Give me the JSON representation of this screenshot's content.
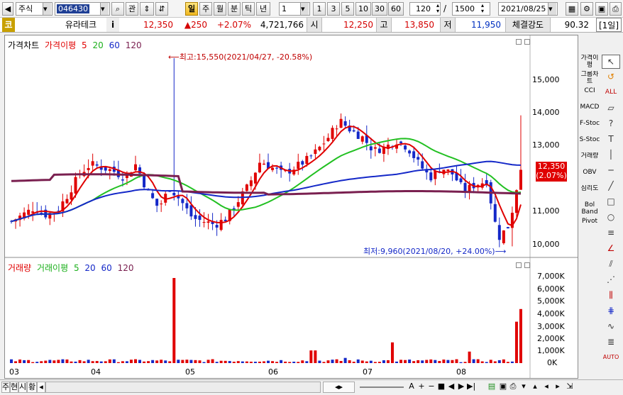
{
  "toolbar": {
    "market": "주식",
    "code": "046430",
    "related_label": "관",
    "periods": [
      "일",
      "주",
      "월",
      "분",
      "틱",
      "년"
    ],
    "interval": "1",
    "multipliers": [
      "1",
      "3",
      "5",
      "10",
      "30",
      "60"
    ],
    "view_count": "120",
    "total_count": "1500",
    "date": "2021/08/25"
  },
  "quote": {
    "market_tag": "코",
    "name": "유라테크",
    "info": "i",
    "price": "12,350",
    "change": "▲250",
    "change_pct": "+2.07%",
    "volume": "4,721,766",
    "open_label": "시",
    "open": "12,250",
    "high_label": "고",
    "high": "13,850",
    "low_label": "저",
    "low": "11,950",
    "strength_label": "체결강도",
    "strength": "90.32",
    "period_badge": "[1일]"
  },
  "price_panel": {
    "legend_main": "가격차트",
    "legend_ma_title": "가격이평",
    "ma_periods": [
      "5",
      "20",
      "60",
      "120"
    ],
    "max_annotation": "최고:15,550(2021/04/27, -20.58%)",
    "min_annotation": "최저:9,960(2021/08/20, +24.00%)",
    "last_price": "12,350",
    "last_pct": "(2.07%)",
    "y_ticks": [
      "15,000",
      "14,000",
      "13,000",
      "12,000",
      "11,000",
      "10,000"
    ]
  },
  "volume_panel": {
    "legend_main": "거래량",
    "legend_ma_title": "거래이평",
    "ma_periods": [
      "5",
      "20",
      "60",
      "120"
    ],
    "y_ticks": [
      "7,000K",
      "6,000K",
      "5,000K",
      "4,000K",
      "3,000K",
      "2,000K",
      "1,000K",
      "0K"
    ]
  },
  "x_ticks": [
    "03",
    "04",
    "05",
    "06",
    "07",
    "08"
  ],
  "right_buttons": [
    "가격이평",
    "그룹차트",
    "CCI",
    "MACD",
    "F-Stoc",
    "S-Stoc",
    "거래량",
    "OBV",
    "심리도",
    "Bol Band",
    "Pivot"
  ],
  "bottom": {
    "tabs": [
      "주",
      "현",
      "시",
      "황"
    ],
    "a_label": "A"
  },
  "colors": {
    "up": "#e00000",
    "down": "#1428c8",
    "ma5": "#e00000",
    "ma20": "#22c022",
    "ma60": "#1428c8",
    "ma120": "#7a2050"
  },
  "chart_data": {
    "type": "candlestick",
    "x": [
      "2021-03",
      "2021-04",
      "2021-05",
      "2021-06",
      "2021-07",
      "2021-08"
    ],
    "price_close_path": [
      10700,
      10900,
      11100,
      10900,
      11000,
      11500,
      12100,
      12400,
      12300,
      12200,
      12000,
      12400,
      11600,
      11100,
      11700,
      11300,
      10800,
      10700,
      10600,
      10800,
      11300,
      11800,
      12500,
      12300,
      12100,
      12300,
      12500,
      12800,
      13200,
      13700,
      13400,
      13200,
      12800,
      12900,
      13100,
      12900,
      12400,
      12000,
      12300,
      12100,
      11600,
      11800,
      11900,
      10200,
      10600,
      12350
    ],
    "max_price": 15550,
    "min_price": 9960,
    "ylim": [
      9800,
      15800
    ],
    "volume_spikes_k": {
      "2021-04-27": 7400,
      "2021-08-24": 3600,
      "2021-08-25": 4700
    }
  }
}
